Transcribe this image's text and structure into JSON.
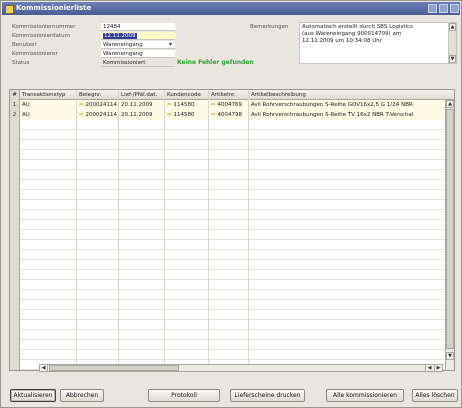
{
  "window": {
    "title": "Kommissionierliste"
  },
  "form": {
    "fields": [
      {
        "label": "Kommissioniernummer",
        "value": "12484"
      },
      {
        "label": "Kommissionierdatum",
        "value": "12.11.2009"
      },
      {
        "label": "Benutzer",
        "value": "Wareneingang"
      },
      {
        "label": "Kommissionierer",
        "value": "Wareneingang"
      },
      {
        "label": "Status",
        "value": "Kommissioniert"
      }
    ],
    "notice": "Keine Fehler gefunden",
    "remarks_label": "Bemerkungen",
    "remarks_lines": [
      "Automatisch erstellt durch SBS Logistics",
      "(aus Wareneingang 900014709) am",
      "12.11.2009 um 10:34:08 Uhr"
    ]
  },
  "table": {
    "columns": [
      "#",
      "Transaktionstyp",
      "Belegnr.",
      "Lief-/Pfäl.dat.",
      "Kundencode",
      "Artikelnr.",
      "Artikelbeschreibung"
    ],
    "rows": [
      {
        "num": "1",
        "type": "AU",
        "doc": "200024114",
        "date": "20.11.2009",
        "cust": "114580",
        "item": "4004769",
        "desc": "Avil Rohrverschraubungen S-Reihe GOV16x2,5 G 1/2A NBR"
      },
      {
        "num": "2",
        "type": "AU",
        "doc": "200024114",
        "date": "20.11.2009",
        "cust": "114580",
        "item": "4004798",
        "desc": "Avil Rohrverschraubungen S-Reihe TV 16x2 NBR T-Verschal"
      }
    ]
  },
  "buttons": {
    "refresh": "Aktualisieren",
    "cancel": "Abbrechen",
    "log": "Protokoll",
    "print": "Lieferscheine drucken",
    "pick_all": "Alle kommissionieren",
    "delete_all": "Alles löschen"
  },
  "icons": {
    "link_arrow": "orange-right-arrow-icon",
    "window_icon": "list-icon"
  },
  "colors": {
    "titlebar": "#4a5d96",
    "notice": "#2da32d",
    "link_arrow": "#e08a00"
  }
}
